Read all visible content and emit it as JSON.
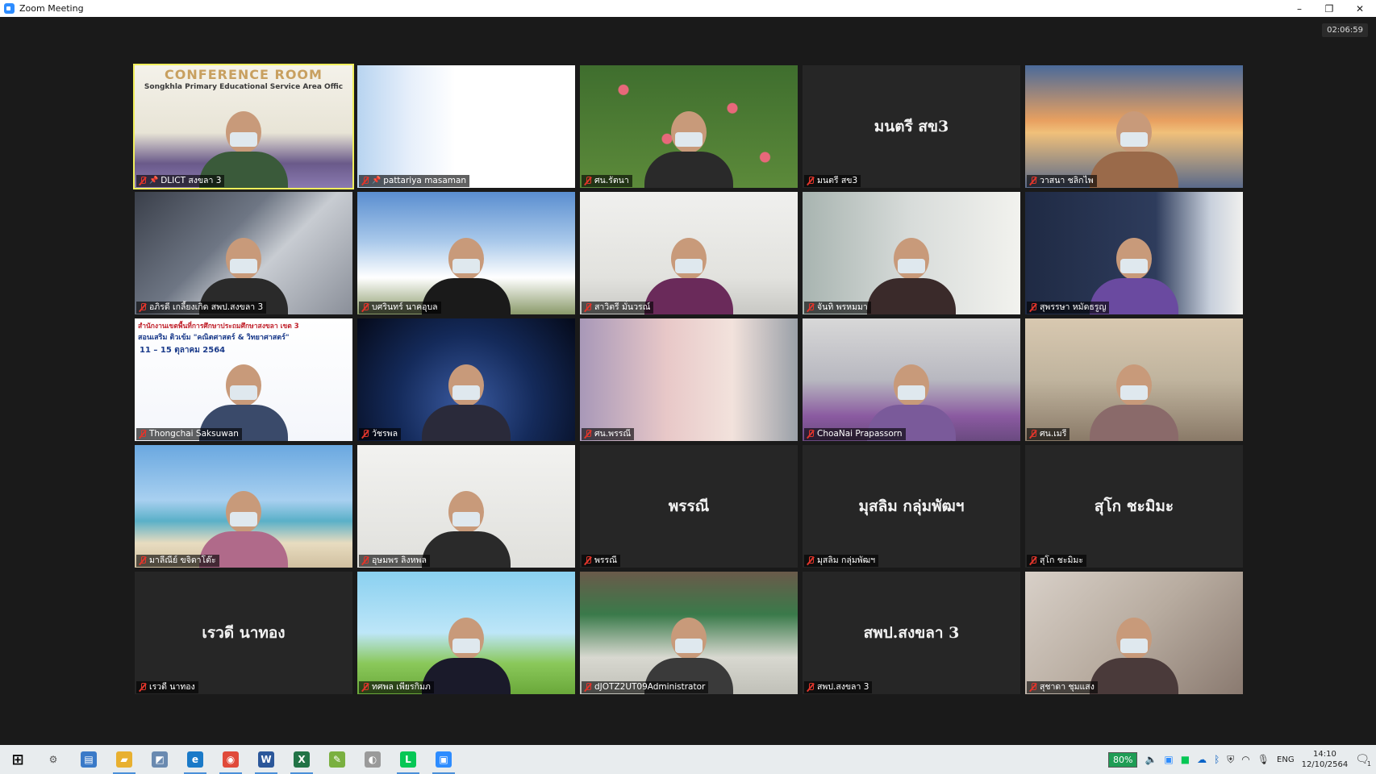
{
  "window": {
    "title": "Zoom Meeting",
    "minimize": "–",
    "restore": "❐",
    "close": "✕"
  },
  "meeting": {
    "timer": "02:06:59"
  },
  "tiles": [
    {
      "name": "DLICT สงขลา 3",
      "pinned": true,
      "active": true,
      "bg": "conference",
      "overlay_title": "CONFERENCE ROOM",
      "overlay_sub": "Songkhla Primary Educational Service Area Offic"
    },
    {
      "name": "pattariya masaman",
      "pinned": true,
      "bg": "slide-white",
      "overlay_title": "",
      "overlay_sub": ""
    },
    {
      "name": "ศน.รัตนา",
      "bg": "flowers"
    },
    {
      "name": "มนตรี สข3",
      "big": "มนตรี สข3"
    },
    {
      "name": "วาสนา ชลิกไพ",
      "bg": "bridge"
    },
    {
      "name": "อภิรดี เกลี้ยงเกิด สพป.สงขลา 3",
      "bg": "phone"
    },
    {
      "name": "บศรินทร์ นาคอุบล",
      "bg": "sky"
    },
    {
      "name": "สาวิตรี มั่นวรณ์",
      "bg": "room-white"
    },
    {
      "name": "จันทิ พรหมมา",
      "bg": "office"
    },
    {
      "name": "สุพรรษา หมัดธรูญ",
      "bg": "library"
    },
    {
      "name": "Thongchai Saksuwan",
      "bg": "banner",
      "overlay_title": "สำนักงานเขตพื้นที่การศึกษาประถมศึกษาสงขลา เขต 3",
      "overlay_sub": "สอนเสริม ติวเข้ม \"คณิตศาสตร์ & วิทยาศาสตร์\"",
      "overlay_date": "11 – 15 ตุลาคม 2564"
    },
    {
      "name": "วัชรพล",
      "bg": "space"
    },
    {
      "name": "ศน.พรรณี",
      "bg": "room-pink"
    },
    {
      "name": "ChoaNai Prapassorn",
      "bg": "room-purple"
    },
    {
      "name": "ศน.เมรี",
      "bg": "classroom"
    },
    {
      "name": "มาลีณีย์ ขจิดาโต๊ะ",
      "bg": "beach"
    },
    {
      "name": "อุษมพร ลิงหพล",
      "bg": "white-wall"
    },
    {
      "name": "พรรณี",
      "big": "พรรณี"
    },
    {
      "name": "มุสลิม กลุ่มพัฒฯ",
      "big": "มุสลิม กลุ่มพัฒฯ"
    },
    {
      "name": "สุโก ชะมิมะ",
      "big": "สุโก ชะมิมะ"
    },
    {
      "name": "เรวดี นาทอง",
      "big": "เรวดี นาทอง"
    },
    {
      "name": "ทศพล เพียรกิมภ",
      "bg": "cartoon"
    },
    {
      "name": "dJOTZ2UT09Administrator",
      "bg": "office-green"
    },
    {
      "name": "สพป.สงขลา 3",
      "big": "สพป.สงขลา 3"
    },
    {
      "name": "สุชาดา ชุมแสง",
      "bg": "indoor"
    }
  ],
  "taskbar": {
    "icons": [
      "windows-start-icon",
      "settings-icon",
      "task-view-icon",
      "file-explorer-icon",
      "app-icon",
      "edge-icon",
      "chrome-icon",
      "word-icon",
      "excel-icon",
      "notepad-icon",
      "media-icon",
      "line-icon",
      "zoom-icon"
    ],
    "battery": "80%",
    "language": "ENG",
    "time": "14:10",
    "date": "12/10/2564",
    "notifications": "1"
  }
}
